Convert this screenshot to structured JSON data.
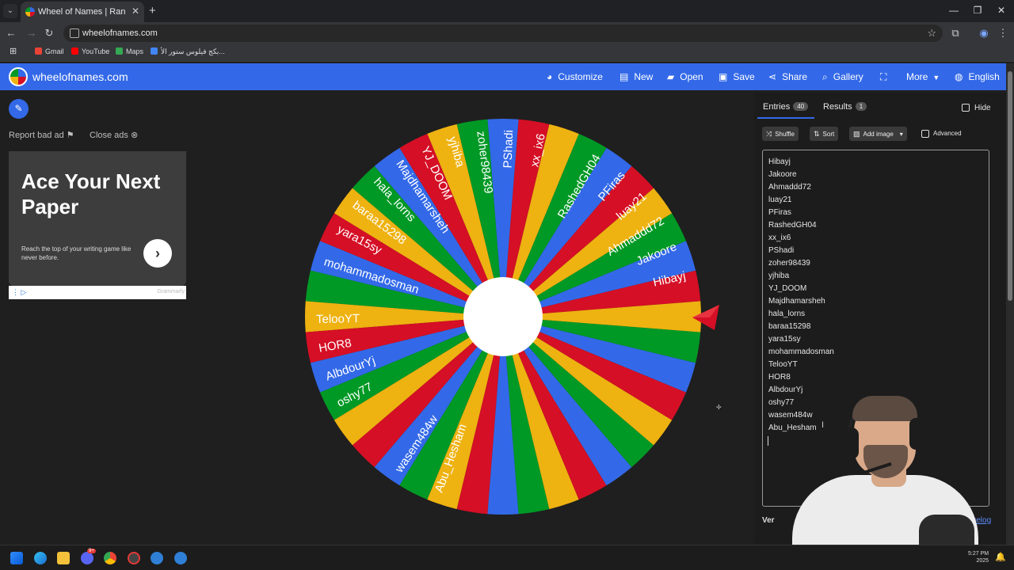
{
  "browser": {
    "tab_title": "Wheel of Names | Random name",
    "url": "wheelofnames.com",
    "bookmarks": [
      {
        "label": "Gmail",
        "color": "#ea4335"
      },
      {
        "label": "YouTube",
        "color": "#ff0000"
      },
      {
        "label": "Maps",
        "color": "#34a853"
      },
      {
        "label": "بكج فيلوس ستور الأ...",
        "color": "#4285f4"
      }
    ]
  },
  "navbar": {
    "brand": "wheelofnames.com",
    "items": [
      {
        "label": "Customize",
        "icon": "palette-icon"
      },
      {
        "label": "New",
        "icon": "file-icon"
      },
      {
        "label": "Open",
        "icon": "folder-icon"
      },
      {
        "label": "Save",
        "icon": "save-icon"
      },
      {
        "label": "Share",
        "icon": "share-icon"
      },
      {
        "label": "Gallery",
        "icon": "search-icon"
      },
      {
        "label": "",
        "icon": "fullscreen-icon"
      },
      {
        "label": "More",
        "icon": "chevron-down-icon"
      },
      {
        "label": "English",
        "icon": "globe-icon"
      }
    ]
  },
  "left": {
    "report_ad": "Report bad ad",
    "close_ads": "Close ads",
    "ad": {
      "title": "Ace Your Next Paper",
      "text": "Reach the top of your writing game like never before.",
      "footer": "Grammarly"
    }
  },
  "wheel": {
    "colors": [
      "#3369e8",
      "#009925",
      "#eeb211",
      "#d50f25"
    ],
    "segment_count": 40,
    "labels": [
      "Hibayj",
      "Jakoore",
      "Ahmaddd72",
      "luay21",
      "PFiras",
      "RashedGH04",
      "xx_ix6",
      "PShadi",
      "zoher98439",
      "yjhiba",
      "YJ_DOOM",
      "Majdhamarsheh",
      "hala_lorns",
      "baraa15298",
      "yara15sy",
      "mohammadosman",
      "TelooYT",
      "HOR8",
      "AlbdourYj",
      "oshy77",
      "wasem484w",
      "Abu_Hesham"
    ]
  },
  "panel": {
    "tabs": [
      {
        "label": "Entries",
        "count": "40"
      },
      {
        "label": "Results",
        "count": "1"
      }
    ],
    "hide_label": "Hide",
    "tools": {
      "shuffle": "Shuffle",
      "sort": "Sort",
      "add_image": "Add image",
      "advanced": "Advanced"
    },
    "entries": [
      "Hibayj",
      "Jakoore",
      "Ahmaddd72",
      "luay21",
      "PFiras",
      "RashedGH04",
      "xx_ix6",
      "PShadi",
      "zoher98439",
      "yjhiba",
      "YJ_DOOM",
      "Majdhamarsheh",
      "hala_lorns",
      "baraa15298",
      "yara15sy",
      "mohammadosman",
      "TelooYT",
      "HOR8",
      "AlbdourYj",
      "oshy77",
      "wasem484w",
      "Abu_Hesham"
    ],
    "version": "Ver",
    "changelog": "changelog"
  },
  "taskbar": {
    "time": "5:27 PM",
    "date": "2025",
    "discord_badge": "9+"
  }
}
